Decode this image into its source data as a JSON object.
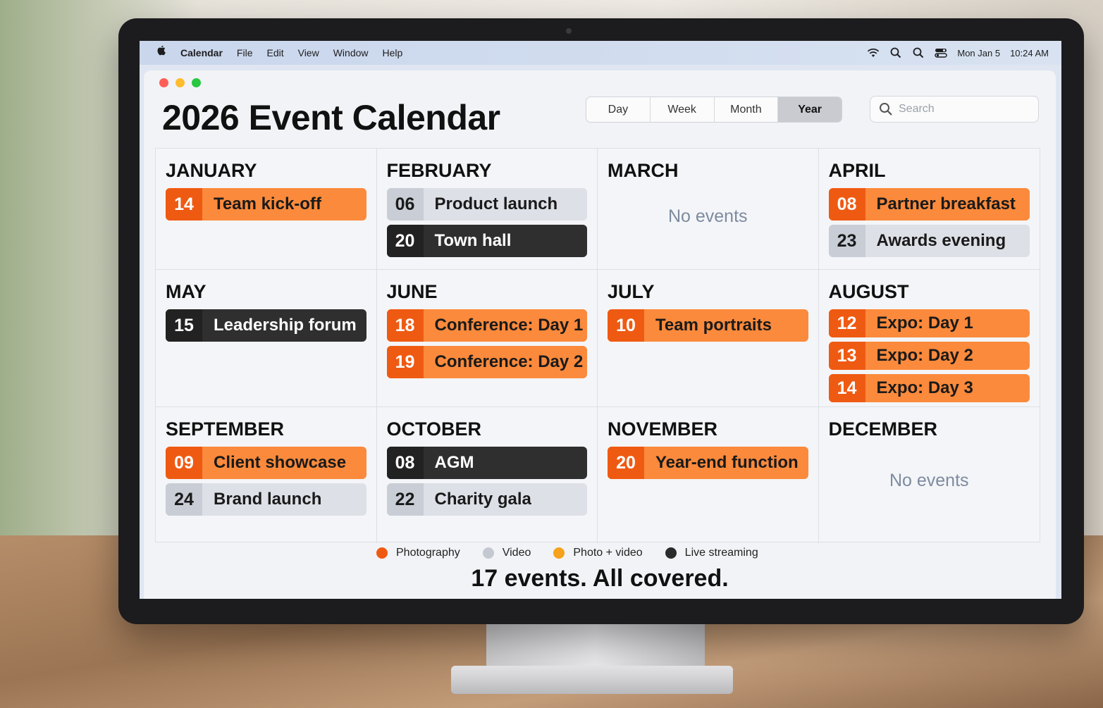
{
  "menubar": {
    "app_name": "Calendar",
    "items": [
      "File",
      "Edit",
      "View",
      "Window",
      "Help"
    ],
    "date": "Mon Jan 5",
    "time": "10:24 AM",
    "icons": [
      "wifi-icon",
      "spotlight-icon",
      "search-icon",
      "control-center-icon"
    ]
  },
  "window": {
    "title": "2026 Event Calendar",
    "views": [
      "Day",
      "Week",
      "Month",
      "Year"
    ],
    "active_view": "Year",
    "search": {
      "placeholder": "Search",
      "value": ""
    }
  },
  "months": [
    {
      "name": "JANUARY",
      "events": [
        {
          "day": "14",
          "title": "Team kick-off",
          "type": "photography"
        }
      ]
    },
    {
      "name": "FEBRUARY",
      "events": [
        {
          "day": "06",
          "title": "Product launch",
          "type": "video"
        },
        {
          "day": "20",
          "title": "Town hall",
          "type": "live"
        }
      ]
    },
    {
      "name": "MARCH",
      "events": [],
      "empty_text": "No events"
    },
    {
      "name": "APRIL",
      "events": [
        {
          "day": "08",
          "title": "Partner breakfast",
          "type": "photography"
        },
        {
          "day": "23",
          "title": "Awards evening",
          "type": "video"
        }
      ]
    },
    {
      "name": "MAY",
      "events": [
        {
          "day": "15",
          "title": "Leadership forum",
          "type": "live"
        }
      ]
    },
    {
      "name": "JUNE",
      "events": [
        {
          "day": "18",
          "title": "Conference: Day 1",
          "type": "photography"
        },
        {
          "day": "19",
          "title": "Conference: Day 2",
          "type": "photography"
        }
      ]
    },
    {
      "name": "JULY",
      "events": [
        {
          "day": "10",
          "title": "Team portraits",
          "type": "photography"
        }
      ]
    },
    {
      "name": "AUGUST",
      "events": [
        {
          "day": "12",
          "title": "Expo: Day 1",
          "type": "photography"
        },
        {
          "day": "13",
          "title": "Expo: Day 2",
          "type": "photography"
        },
        {
          "day": "14",
          "title": "Expo: Day 3",
          "type": "photography"
        }
      ]
    },
    {
      "name": "SEPTEMBER",
      "events": [
        {
          "day": "09",
          "title": "Client showcase",
          "type": "photography"
        },
        {
          "day": "24",
          "title": "Brand launch",
          "type": "video"
        }
      ]
    },
    {
      "name": "OCTOBER",
      "events": [
        {
          "day": "08",
          "title": "AGM",
          "type": "live"
        },
        {
          "day": "22",
          "title": "Charity gala",
          "type": "video"
        }
      ]
    },
    {
      "name": "NOVEMBER",
      "events": [
        {
          "day": "20",
          "title": "Year-end function",
          "type": "photography"
        }
      ]
    },
    {
      "name": "DECEMBER",
      "events": [],
      "empty_text": "No events"
    }
  ],
  "legend": [
    {
      "label": "Photography",
      "color": "#ef5a12"
    },
    {
      "label": "Video",
      "color": "#c4c8d0"
    },
    {
      "label": "Photo + video",
      "color": "#f6a21c"
    },
    {
      "label": "Live streaming",
      "color": "#2b2b2b"
    }
  ],
  "tagline": "17 events. All covered."
}
